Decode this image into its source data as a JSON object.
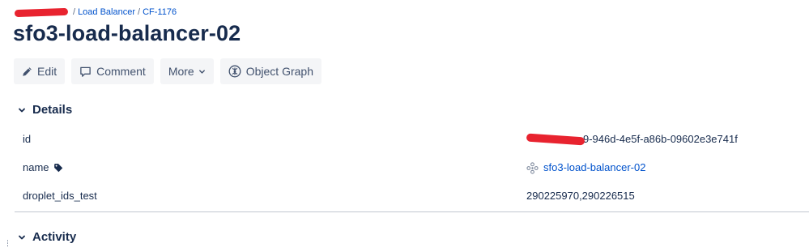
{
  "breadcrumb": {
    "items": [
      "Load Balancer",
      "CF-1176"
    ],
    "separator": "/"
  },
  "page": {
    "title": "sfo3-load-balancer-02"
  },
  "toolbar": {
    "edit_label": "Edit",
    "comment_label": "Comment",
    "more_label": "More",
    "object_graph_label": "Object Graph"
  },
  "details": {
    "header": "Details",
    "rows": [
      {
        "name": "id",
        "value": "9-946d-4e5f-a86b-09602e3e741f"
      },
      {
        "name": "name",
        "value": "sfo3-load-balancer-02"
      },
      {
        "name": "droplet_ids_test",
        "value": "290225970,290226515"
      }
    ]
  },
  "activity": {
    "header": "Activity"
  },
  "colors": {
    "link": "#0052cc",
    "text": "#172b4d",
    "button_bg": "#f4f5f7",
    "redaction": "#e8232f",
    "divider": "#c1c7d0"
  },
  "icons": {
    "edit": "pencil-icon",
    "comment": "speech-bubble-icon",
    "more": "chevron-down-icon",
    "object_graph": "graph-icon",
    "section_toggle": "chevron-down-icon",
    "tag": "tag-icon",
    "object": "object-icon"
  }
}
